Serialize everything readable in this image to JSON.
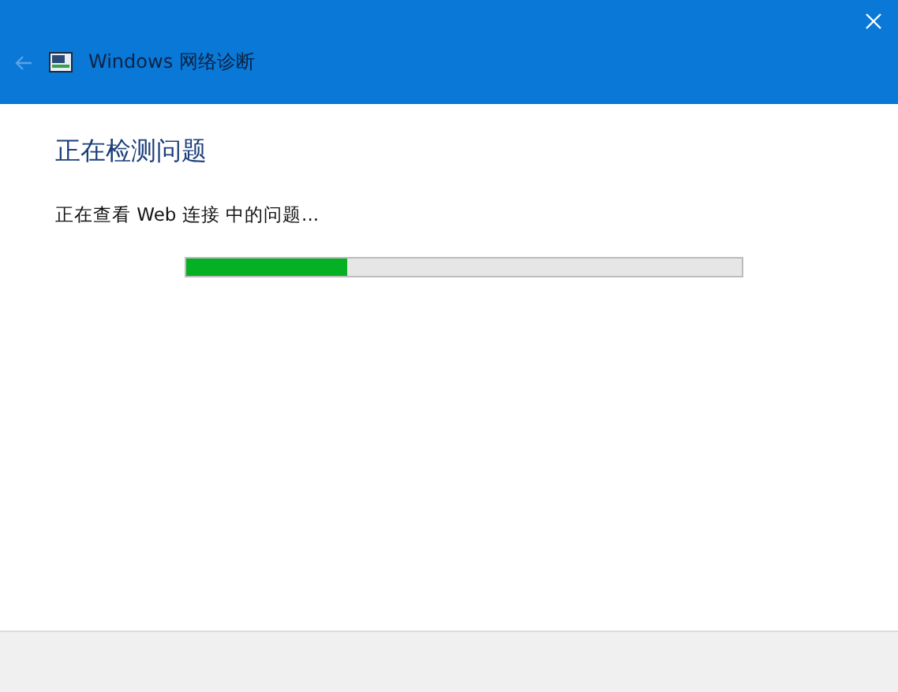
{
  "window": {
    "title": "Windows 网络诊断"
  },
  "heading": "正在检测问题",
  "status": "正在查看 Web 连接 中的问题...",
  "progress": {
    "level": 0.29
  }
}
